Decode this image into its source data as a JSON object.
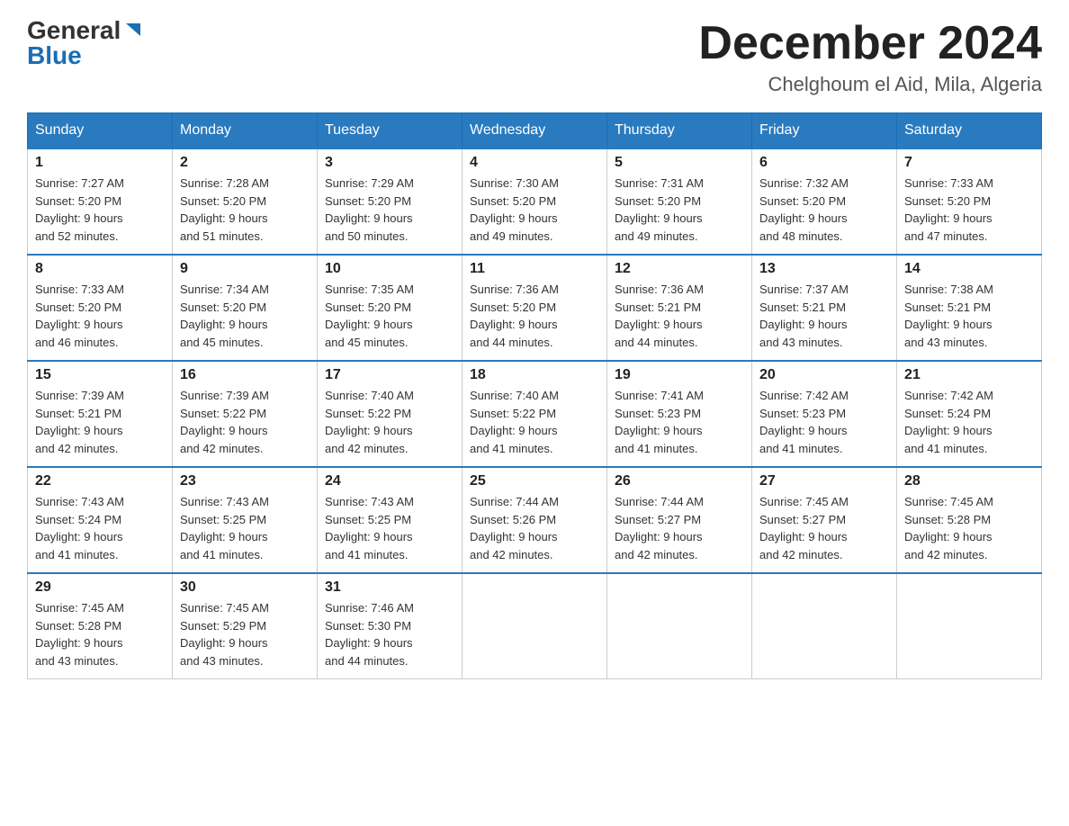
{
  "header": {
    "logo_general": "General",
    "logo_blue": "Blue",
    "month_title": "December 2024",
    "location": "Chelghoum el Aid, Mila, Algeria"
  },
  "weekdays": [
    "Sunday",
    "Monday",
    "Tuesday",
    "Wednesday",
    "Thursday",
    "Friday",
    "Saturday"
  ],
  "weeks": [
    [
      {
        "day": "1",
        "sunrise": "7:27 AM",
        "sunset": "5:20 PM",
        "daylight": "9 hours and 52 minutes."
      },
      {
        "day": "2",
        "sunrise": "7:28 AM",
        "sunset": "5:20 PM",
        "daylight": "9 hours and 51 minutes."
      },
      {
        "day": "3",
        "sunrise": "7:29 AM",
        "sunset": "5:20 PM",
        "daylight": "9 hours and 50 minutes."
      },
      {
        "day": "4",
        "sunrise": "7:30 AM",
        "sunset": "5:20 PM",
        "daylight": "9 hours and 49 minutes."
      },
      {
        "day": "5",
        "sunrise": "7:31 AM",
        "sunset": "5:20 PM",
        "daylight": "9 hours and 49 minutes."
      },
      {
        "day": "6",
        "sunrise": "7:32 AM",
        "sunset": "5:20 PM",
        "daylight": "9 hours and 48 minutes."
      },
      {
        "day": "7",
        "sunrise": "7:33 AM",
        "sunset": "5:20 PM",
        "daylight": "9 hours and 47 minutes."
      }
    ],
    [
      {
        "day": "8",
        "sunrise": "7:33 AM",
        "sunset": "5:20 PM",
        "daylight": "9 hours and 46 minutes."
      },
      {
        "day": "9",
        "sunrise": "7:34 AM",
        "sunset": "5:20 PM",
        "daylight": "9 hours and 45 minutes."
      },
      {
        "day": "10",
        "sunrise": "7:35 AM",
        "sunset": "5:20 PM",
        "daylight": "9 hours and 45 minutes."
      },
      {
        "day": "11",
        "sunrise": "7:36 AM",
        "sunset": "5:20 PM",
        "daylight": "9 hours and 44 minutes."
      },
      {
        "day": "12",
        "sunrise": "7:36 AM",
        "sunset": "5:21 PM",
        "daylight": "9 hours and 44 minutes."
      },
      {
        "day": "13",
        "sunrise": "7:37 AM",
        "sunset": "5:21 PM",
        "daylight": "9 hours and 43 minutes."
      },
      {
        "day": "14",
        "sunrise": "7:38 AM",
        "sunset": "5:21 PM",
        "daylight": "9 hours and 43 minutes."
      }
    ],
    [
      {
        "day": "15",
        "sunrise": "7:39 AM",
        "sunset": "5:21 PM",
        "daylight": "9 hours and 42 minutes."
      },
      {
        "day": "16",
        "sunrise": "7:39 AM",
        "sunset": "5:22 PM",
        "daylight": "9 hours and 42 minutes."
      },
      {
        "day": "17",
        "sunrise": "7:40 AM",
        "sunset": "5:22 PM",
        "daylight": "9 hours and 42 minutes."
      },
      {
        "day": "18",
        "sunrise": "7:40 AM",
        "sunset": "5:22 PM",
        "daylight": "9 hours and 41 minutes."
      },
      {
        "day": "19",
        "sunrise": "7:41 AM",
        "sunset": "5:23 PM",
        "daylight": "9 hours and 41 minutes."
      },
      {
        "day": "20",
        "sunrise": "7:42 AM",
        "sunset": "5:23 PM",
        "daylight": "9 hours and 41 minutes."
      },
      {
        "day": "21",
        "sunrise": "7:42 AM",
        "sunset": "5:24 PM",
        "daylight": "9 hours and 41 minutes."
      }
    ],
    [
      {
        "day": "22",
        "sunrise": "7:43 AM",
        "sunset": "5:24 PM",
        "daylight": "9 hours and 41 minutes."
      },
      {
        "day": "23",
        "sunrise": "7:43 AM",
        "sunset": "5:25 PM",
        "daylight": "9 hours and 41 minutes."
      },
      {
        "day": "24",
        "sunrise": "7:43 AM",
        "sunset": "5:25 PM",
        "daylight": "9 hours and 41 minutes."
      },
      {
        "day": "25",
        "sunrise": "7:44 AM",
        "sunset": "5:26 PM",
        "daylight": "9 hours and 42 minutes."
      },
      {
        "day": "26",
        "sunrise": "7:44 AM",
        "sunset": "5:27 PM",
        "daylight": "9 hours and 42 minutes."
      },
      {
        "day": "27",
        "sunrise": "7:45 AM",
        "sunset": "5:27 PM",
        "daylight": "9 hours and 42 minutes."
      },
      {
        "day": "28",
        "sunrise": "7:45 AM",
        "sunset": "5:28 PM",
        "daylight": "9 hours and 42 minutes."
      }
    ],
    [
      {
        "day": "29",
        "sunrise": "7:45 AM",
        "sunset": "5:28 PM",
        "daylight": "9 hours and 43 minutes."
      },
      {
        "day": "30",
        "sunrise": "7:45 AM",
        "sunset": "5:29 PM",
        "daylight": "9 hours and 43 minutes."
      },
      {
        "day": "31",
        "sunrise": "7:46 AM",
        "sunset": "5:30 PM",
        "daylight": "9 hours and 44 minutes."
      },
      null,
      null,
      null,
      null
    ]
  ],
  "labels": {
    "sunrise": "Sunrise:",
    "sunset": "Sunset:",
    "daylight": "Daylight:"
  }
}
